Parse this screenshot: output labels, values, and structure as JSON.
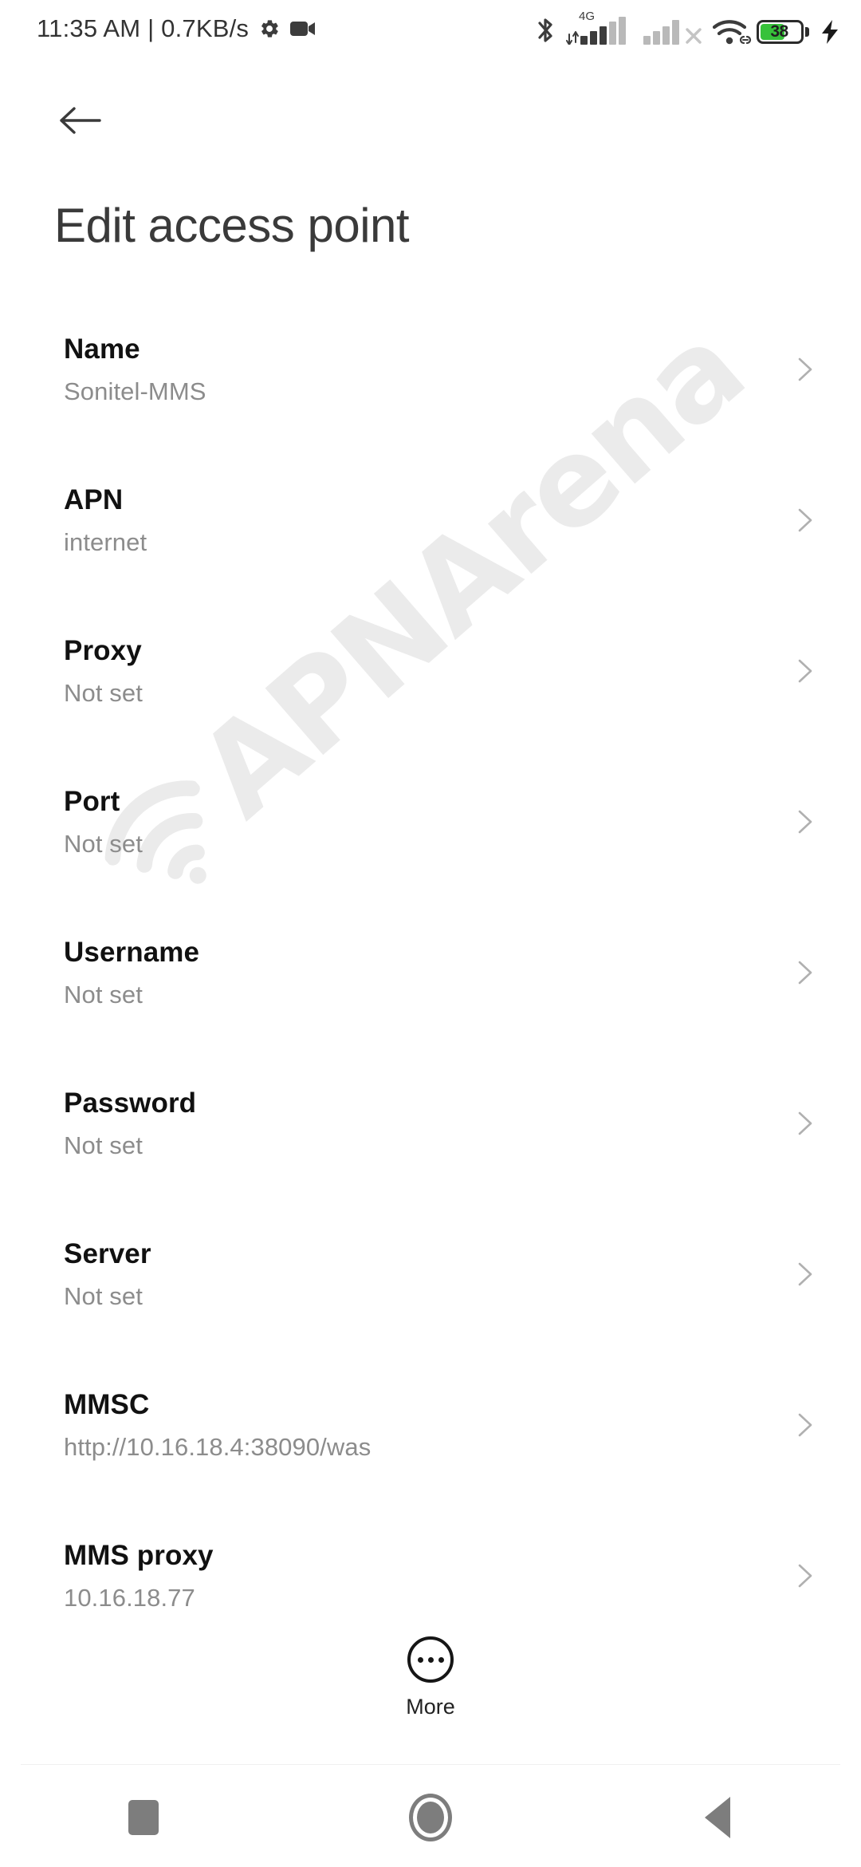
{
  "status_bar": {
    "clock": "11:35 AM | 0.7KB/s",
    "icons": {
      "gear": "gear-icon",
      "camcorder": "camcorder-icon",
      "bluetooth": "bluetooth-icon",
      "sim1_network": "4G",
      "sim1_signal": "signal-bars-icon",
      "sim2_signal": "signal-bars-no-service-icon",
      "wifi": "wifi-icon",
      "wifi_link": "link-icon",
      "battery_level": "38",
      "charging": "charging-bolt-icon"
    },
    "colors": {
      "battery_fill": "#37c23a",
      "icon": "#3c3c3c"
    }
  },
  "app_bar": {
    "back_label": "back-arrow",
    "title": "Edit access point"
  },
  "settings": {
    "rows": [
      {
        "label": "Name",
        "value": "Sonitel-MMS"
      },
      {
        "label": "APN",
        "value": "internet"
      },
      {
        "label": "Proxy",
        "value": "Not set"
      },
      {
        "label": "Port",
        "value": "Not set"
      },
      {
        "label": "Username",
        "value": "Not set"
      },
      {
        "label": "Password",
        "value": "Not set"
      },
      {
        "label": "Server",
        "value": "Not set"
      },
      {
        "label": "MMSC",
        "value": "http://10.16.18.4:38090/was"
      },
      {
        "label": "MMS proxy",
        "value": "10.16.18.77"
      }
    ]
  },
  "more_button": {
    "label": "More",
    "icon": "more-dots-circle-icon"
  },
  "watermark": {
    "text": "APNArena"
  },
  "nav_bar": {
    "recents": "recents-square-icon",
    "home": "home-circle-icon",
    "back": "back-triangle-icon"
  }
}
